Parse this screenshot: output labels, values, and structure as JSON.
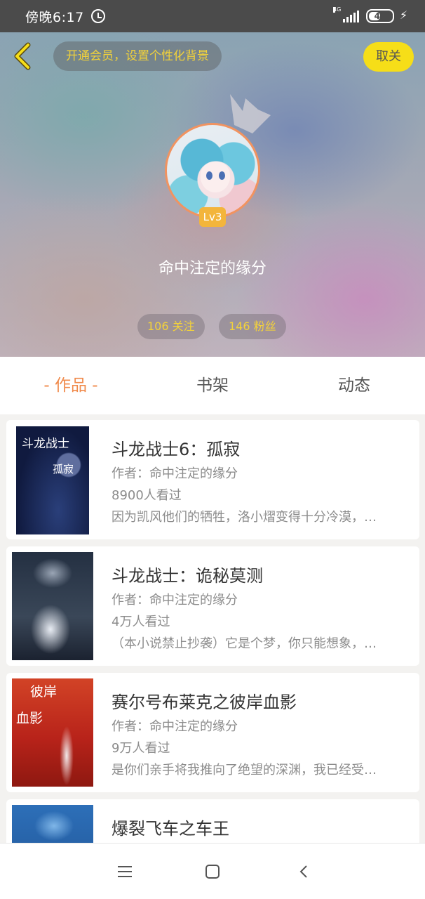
{
  "status_bar": {
    "time": "傍晚6:17",
    "network": "4G",
    "battery": "41"
  },
  "header": {
    "vip_prompt": "开通会员，设置个性化背景",
    "unfollow_label": "取关"
  },
  "profile": {
    "level": "Lv3",
    "username": "命中注定的缘分",
    "following": "106 关注",
    "fans": "146 粉丝"
  },
  "tabs": [
    {
      "label": "- 作品 -",
      "active": true
    },
    {
      "label": "书架",
      "active": false
    },
    {
      "label": "动态",
      "active": false
    }
  ],
  "books": [
    {
      "title": "斗龙战士6：孤寂",
      "author": "作者：命中注定的缘分",
      "views": "8900人看过",
      "desc": "因为凯风他们的牺牲，洛小熠变得十分冷漠，…",
      "cover_text": [
        "斗龙战士",
        "孤寂"
      ]
    },
    {
      "title": "斗龙战士：诡秘莫测",
      "author": "作者：命中注定的缘分",
      "views": "4万人看过",
      "desc": "（本小说禁止抄袭）它是个梦，你只能想象，…",
      "cover_text": []
    },
    {
      "title": "赛尔号布莱克之彼岸血影",
      "author": "作者：命中注定的缘分",
      "views": "9万人看过",
      "desc": "是你们亲手将我推向了绝望的深渊，我已经受…",
      "cover_text": [
        "彼岸",
        "血影"
      ]
    },
    {
      "title": "爆裂飞车之车王",
      "author": "",
      "views": "",
      "desc": "",
      "cover_text": []
    }
  ],
  "colors": {
    "accent_orange": "#f08a4b",
    "accent_yellow": "#f6de18",
    "stat_text": "#f3d23a"
  }
}
